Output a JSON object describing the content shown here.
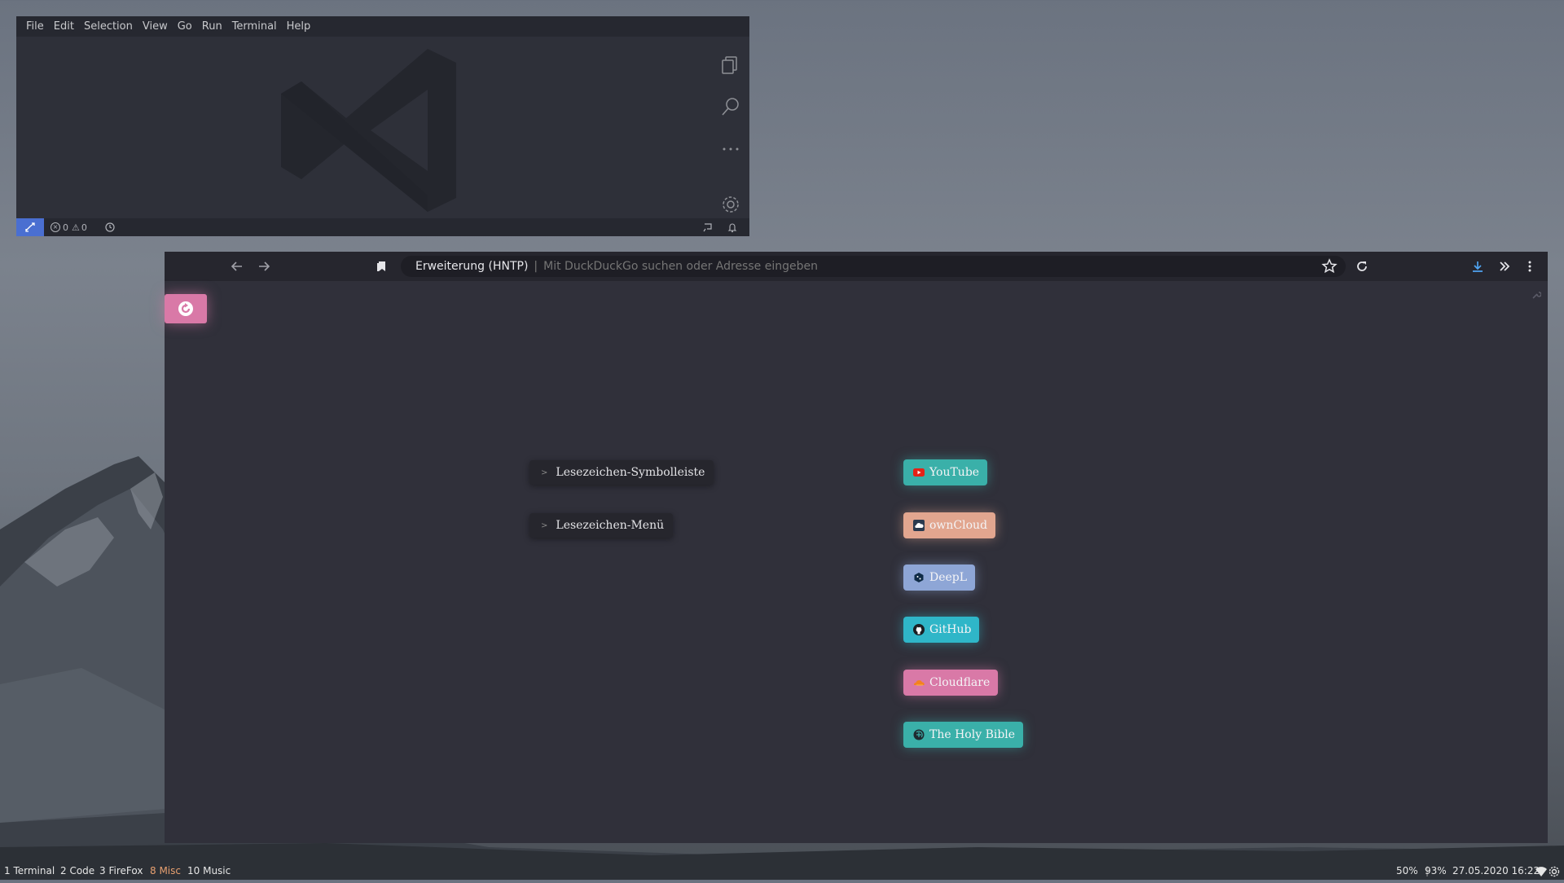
{
  "vscode": {
    "menu": [
      "File",
      "Edit",
      "Selection",
      "View",
      "Go",
      "Run",
      "Terminal",
      "Help"
    ],
    "status": {
      "errors": "0",
      "warnings": "0"
    },
    "sidebar_icons": [
      "copy-icon",
      "search-icon",
      "ellipsis-icon",
      "gear-icon"
    ]
  },
  "browser": {
    "url_extension": "Erweiterung (HNTP)",
    "url_separator": "|",
    "url_placeholder": "Mit DuckDuckGo suchen oder Adresse eingeben",
    "folders": [
      "Lesezeichen-Symbolleiste",
      "Lesezeichen-Menü"
    ],
    "bookmarks": [
      {
        "label": "YouTube",
        "color": "#3ab0a9",
        "icon": "youtube-icon"
      },
      {
        "label": "ownCloud",
        "color": "#e2a68f",
        "icon": "owncloud-icon"
      },
      {
        "label": "DeepL",
        "color": "#8ea6d6",
        "icon": "deepl-icon"
      },
      {
        "label": "GitHub",
        "color": "#2fb6c8",
        "icon": "github-icon"
      },
      {
        "label": "Cloudflare",
        "color": "#d979a7",
        "icon": "cloudflare-icon"
      },
      {
        "label": "The Holy Bible",
        "color": "#3ab0a9",
        "icon": "bible-icon"
      }
    ]
  },
  "taskbar": {
    "workspaces": [
      {
        "label": "1 Terminal",
        "active": false
      },
      {
        "label": "2 Code",
        "active": false
      },
      {
        "label": "3 FireFox",
        "active": false
      },
      {
        "label": "8 Misc",
        "active": true
      },
      {
        "label": "10 Music",
        "active": false
      }
    ],
    "volume": "50%",
    "battery": "93%",
    "datetime": "27.05.2020 16:22"
  },
  "colors": {
    "accent_pink": "#d979a7",
    "active_workspace": "#e8a070",
    "vscode_remote": "#4a6fd1"
  }
}
